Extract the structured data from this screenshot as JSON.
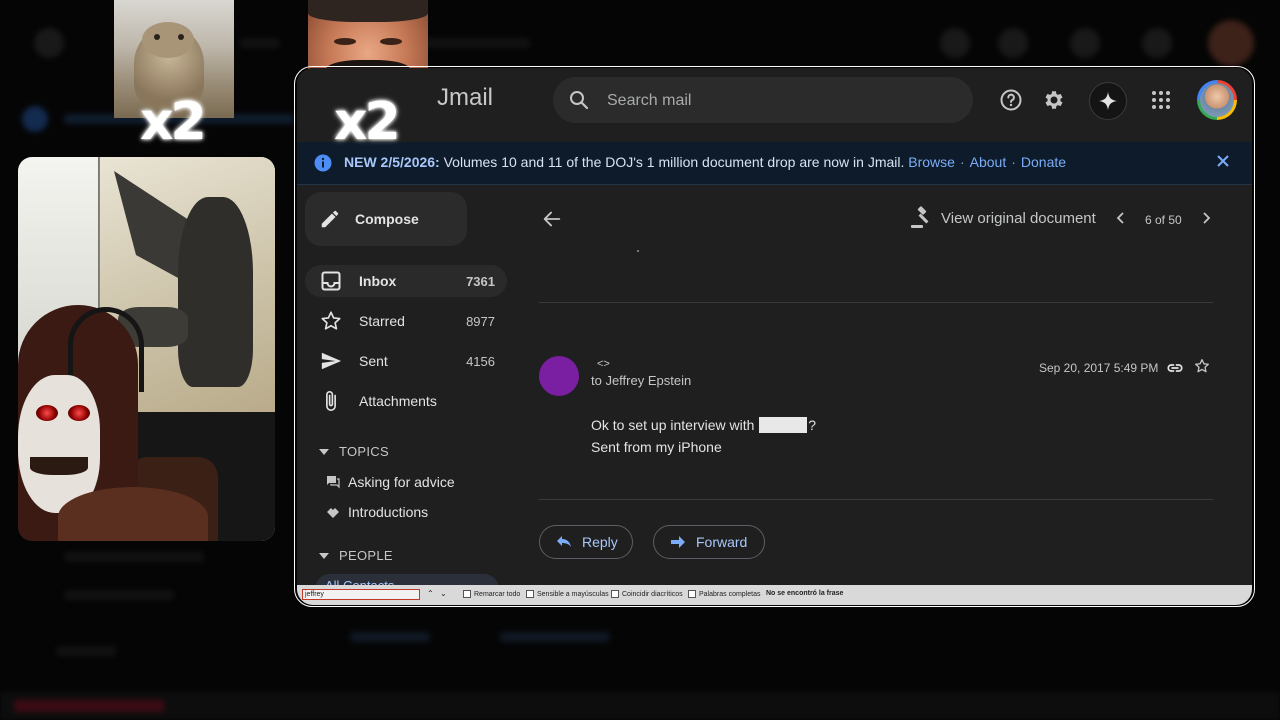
{
  "overlays": {
    "multiplier_left": "x2",
    "multiplier_right": "x2"
  },
  "app": {
    "name": "Jmail"
  },
  "search": {
    "placeholder": "Search mail"
  },
  "banner": {
    "prefix": "NEW 2/5/2026:",
    "text": "Volumes 10 and 11 of the DOJ's 1 million document drop are now in Jmail.",
    "links": [
      "Browse",
      "About",
      "Donate"
    ]
  },
  "sidebar": {
    "compose_label": "Compose",
    "items": [
      {
        "label": "Inbox",
        "count": "7361",
        "icon": "inbox-icon"
      },
      {
        "label": "Starred",
        "count": "8977",
        "icon": "star-icon"
      },
      {
        "label": "Sent",
        "count": "4156",
        "icon": "send-icon"
      },
      {
        "label": "Attachments",
        "count": "",
        "icon": "paperclip-icon"
      }
    ],
    "topics_heading": "TOPICS",
    "topics": [
      "Asking for advice",
      "Introductions"
    ],
    "people_heading": "PEOPLE",
    "people_first": "All Contacts"
  },
  "toolbar": {
    "view_original": "View original document",
    "pager": "6 of 50"
  },
  "message": {
    "sender": "<>",
    "to": "to Jeffrey Epstein",
    "date": "Sep 20, 2017 5:49 PM",
    "body_line1_before": "Ok to set up interview with",
    "body_line1_after": "?",
    "body_line2": "Sent from my iPhone",
    "reply_label": "Reply",
    "forward_label": "Forward"
  },
  "findbar": {
    "query": "jeffrey",
    "options": [
      "Remarcar todo",
      "Sensible a mayúsculas",
      "Coincidir diacríticos",
      "Palabras completas"
    ],
    "status": "No se encontró la frase"
  },
  "colors": {
    "accent": "#a8c7fa",
    "sender_avatar": "#7b1fa2",
    "banner_bg": "#0d1b2a"
  }
}
